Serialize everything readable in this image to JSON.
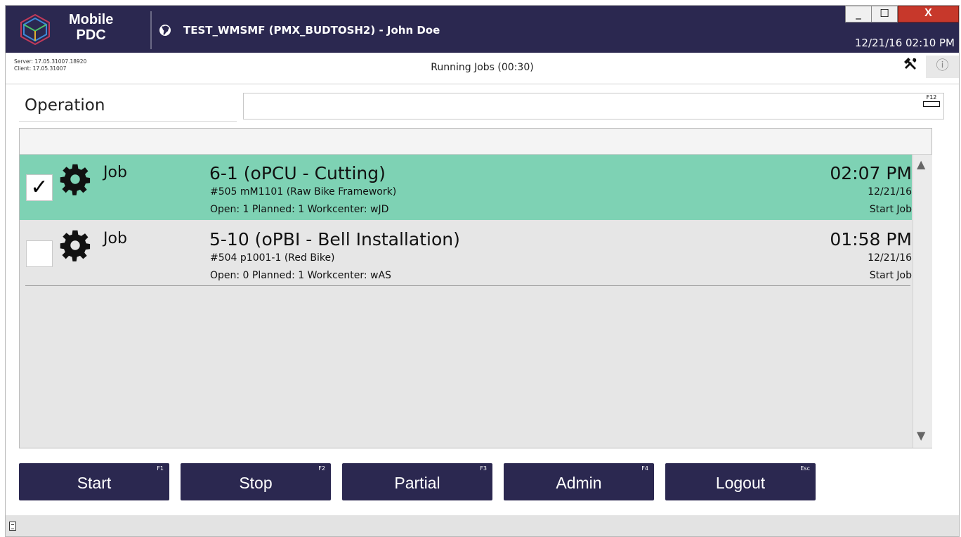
{
  "titlebar": {
    "brand_line1": "Mobile",
    "brand_line2": "PDC",
    "app_title": "TEST_WMSMF (PMX_BUDTOSH2) - John Doe",
    "datetime": "12/21/16 02:10 PM",
    "controls": {
      "minimize": "_",
      "maximize": "☐",
      "close": "X"
    }
  },
  "info": {
    "server": "Server: 17.05.31007.18920",
    "client": "Client: 17.05.31007",
    "running_jobs": "Running Jobs (00:30)",
    "tools_icon": "tools-icon",
    "info_icon": "ⓘ"
  },
  "operation": {
    "label": "Operation",
    "value": "",
    "placeholder": "",
    "keyboard_key": "F12"
  },
  "jobs": [
    {
      "selected": true,
      "check": "✓",
      "type": "Job",
      "title": "6-1 (oPCU - Cutting)",
      "subtitle": "#505 mM1101 (Raw Bike Framework)",
      "info": "Open: 1 Planned: 1 Workcenter: wJD",
      "time": "02:07 PM",
      "date": "12/21/16",
      "action": "Start Job"
    },
    {
      "selected": false,
      "check": "",
      "type": "Job",
      "title": "5-10 (oPBI - Bell Installation)",
      "subtitle": "#504 p1001-1 (Red Bike)",
      "info": "Open: 0 Planned: 1 Workcenter: wAS",
      "time": "01:58 PM",
      "date": "12/21/16",
      "action": "Start Job"
    }
  ],
  "scroll": {
    "up": "▲",
    "down": "▼"
  },
  "buttons": [
    {
      "label": "Start",
      "key": "F1"
    },
    {
      "label": "Stop",
      "key": "F2"
    },
    {
      "label": "Partial",
      "key": "F3"
    },
    {
      "label": "Admin",
      "key": "F4"
    },
    {
      "label": "Logout",
      "key": "Esc"
    }
  ],
  "colors": {
    "titlebar": "#2b2850",
    "selected_row": "#7ed2b4",
    "button": "#2b2850",
    "close": "#c7382b"
  }
}
